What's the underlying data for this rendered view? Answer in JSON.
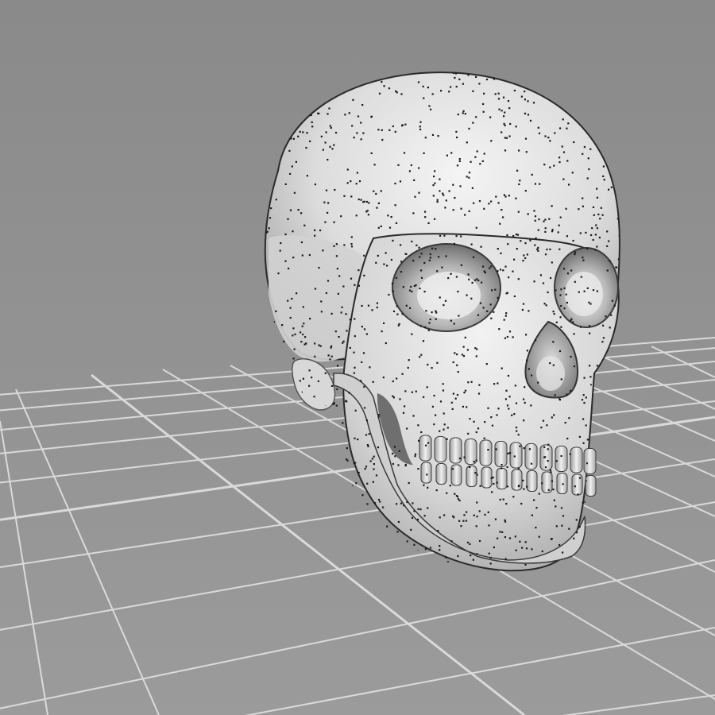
{
  "viewport": {
    "object": "skull-model",
    "view": "perspective",
    "ground_grid": true,
    "vertex_points_visible": true,
    "colors": {
      "background_top": "#8a8a8a",
      "background_bottom": "#9a9a9a",
      "grid_line": "#e6e6e6",
      "model_surface": "#dedede",
      "model_shadow": "#7c7c7c",
      "vertex_point": "#1a1a1a"
    }
  }
}
